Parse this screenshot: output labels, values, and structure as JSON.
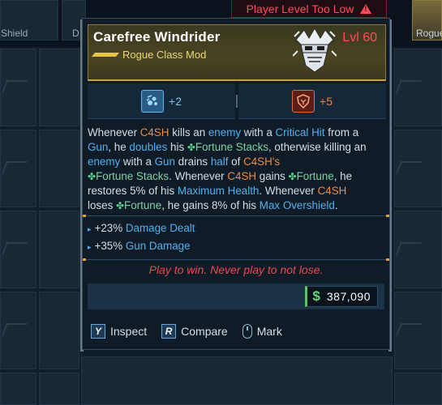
{
  "background": {
    "left_label_shield": "Shield",
    "left_label_d": "D",
    "right_label_rogue": "Rogue"
  },
  "warning": {
    "text": "Player Level Too Low",
    "icon": "warning-triangle-icon",
    "color": "#ff4c5a"
  },
  "item": {
    "name": "Carefree Windrider",
    "type": "Rogue Class Mod",
    "level": "Lvl 60",
    "rarity_color": "#c9a23a",
    "portrait_icon": "rogue-mask-icon"
  },
  "stats": [
    {
      "icon": "blue-skill-icon",
      "value": "+2",
      "color": "#7fc2e8"
    },
    {
      "icon": "shield-emblem-icon",
      "value": "+5",
      "color": "#e8804a"
    }
  ],
  "description": {
    "p1": "Whenever ",
    "c4sh1": "C4SH",
    "p2": " kills an ",
    "enemy1": "enemy",
    "p3": " with a ",
    "crit": "Critical Hit",
    "p4": " from a ",
    "gun1": "Gun",
    "p5": ", he ",
    "doubles": "doubles",
    "p6": " his ",
    "fortune_stacks1": "Fortune Stacks",
    "p7": ", otherwise killing an ",
    "enemy2": "enemy",
    "p8": " with a ",
    "gun2": "Gun",
    "p9": " drains ",
    "half": "half",
    "p10": " of ",
    "c4shs": "C4SH's",
    "fortune_stacks2": "Fortune Stacks",
    "p11": ". Whenever ",
    "c4sh2": "C4SH",
    "p12": " gains ",
    "fortune1": "Fortune",
    "p13": ", he restores 5% of his ",
    "max_health": "Maximum Health",
    "p14": ". Whenever ",
    "c4sh3": "C4SH",
    "p15": " loses ",
    "fortune2": "Fortune",
    "p16": ", he gains 8% of his ",
    "max_overshield": "Max Overshield",
    "p17": "."
  },
  "bonuses": [
    {
      "amount": "+23%",
      "label": "Damage Dealt"
    },
    {
      "amount": "+35%",
      "label": "Gun Damage"
    }
  ],
  "flavor_text": "Play to win. Never play to not lose.",
  "price": {
    "currency_symbol": "$",
    "value": "387,090"
  },
  "actions": [
    {
      "key": "Y",
      "label": "Inspect"
    },
    {
      "key": "R",
      "label": "Compare"
    },
    {
      "icon": "mouse-icon",
      "label": "Mark"
    }
  ]
}
